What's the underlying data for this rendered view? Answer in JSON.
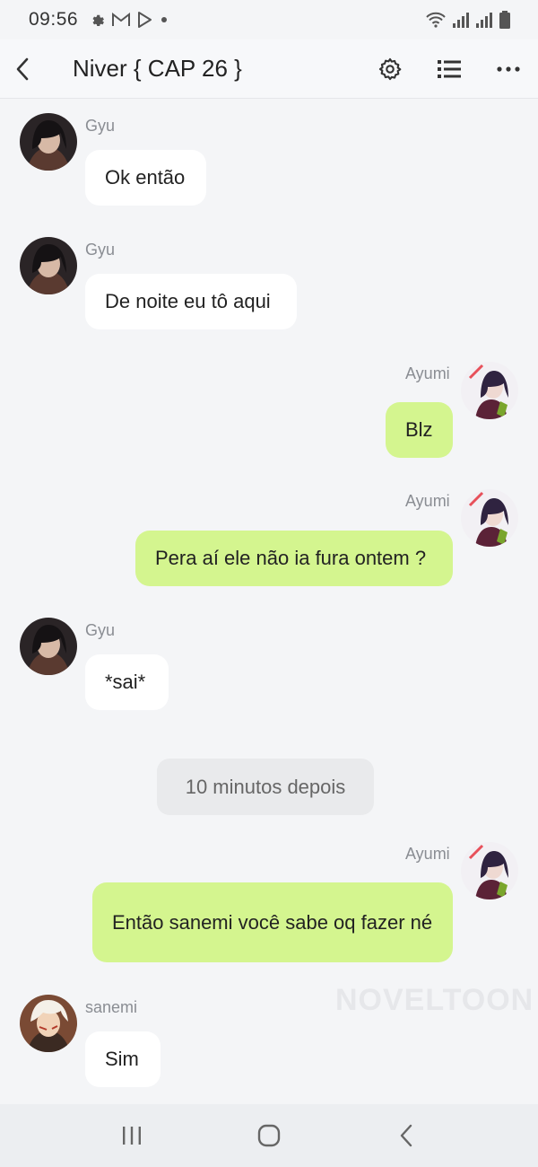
{
  "status_bar": {
    "time": "09:56",
    "icons": [
      "settings-icon",
      "gmail-icon",
      "play-store-icon",
      "dot-icon",
      "wifi-icon",
      "signal-icon",
      "signal-icon",
      "battery-icon"
    ]
  },
  "header": {
    "title": "Niver { CAP 26 }",
    "icons": [
      "back-icon",
      "settings-icon",
      "list-icon",
      "more-icon"
    ]
  },
  "messages": [
    {
      "sender": "Gyu",
      "text": "Ok então",
      "side": "in"
    },
    {
      "sender": "Gyu",
      "text": "De noite eu tô aqui",
      "side": "in"
    },
    {
      "sender": "Ayumi",
      "text": "Blz",
      "side": "out"
    },
    {
      "sender": "Ayumi",
      "text": "Pera aí ele não ia fura ontem ?",
      "side": "out"
    },
    {
      "sender": "Gyu",
      "text": "*sai*",
      "side": "in"
    },
    {
      "sender": "Ayumi",
      "text": "Então sanemi você sabe oq fazer né",
      "side": "out"
    },
    {
      "sender": "sanemi",
      "text": "Sim",
      "side": "in"
    }
  ],
  "timestamp": "10 minutos depois",
  "watermark": "NOVELTOON",
  "colors": {
    "background": "#f4f5f7",
    "incoming_bubble": "#ffffff",
    "outgoing_bubble": "#d4f58f",
    "sender_name": "#8a8d93"
  },
  "navbar": {
    "icons": [
      "recent-apps-icon",
      "home-icon",
      "back-icon"
    ]
  }
}
